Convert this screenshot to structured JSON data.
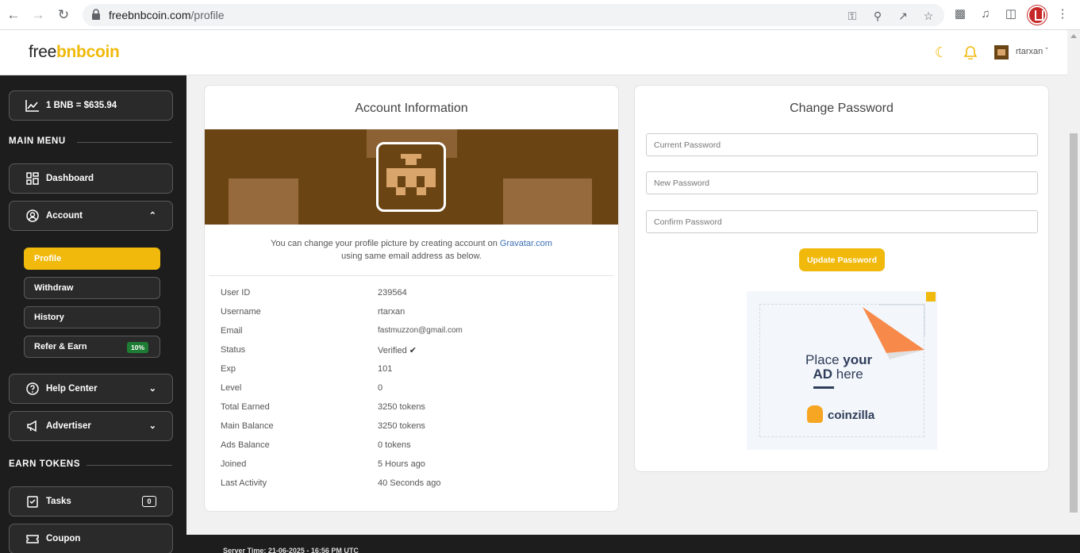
{
  "browser": {
    "url_host": "freebnbcoin.com",
    "url_path": "/profile"
  },
  "header": {
    "logo_part1": "free",
    "logo_part2": "bnbcoin",
    "username": "rtarxan"
  },
  "sidebar": {
    "price": "1 BNB = $635.94",
    "main_menu_heading": "MAIN MENU",
    "dashboard": "Dashboard",
    "account": "Account",
    "sub_items": [
      "Profile",
      "Withdraw",
      "History",
      "Refer & Earn"
    ],
    "refer_badge": "10%",
    "help_center": "Help Center",
    "advertiser": "Advertiser",
    "earn_heading": "EARN TOKENS",
    "tasks": "Tasks",
    "tasks_count": "0",
    "coupon": "Coupon"
  },
  "account_info": {
    "title": "Account Information",
    "note_before": "You can change your profile picture by creating account on ",
    "note_link": "Gravatar.com",
    "note_after": " using same email address as below.",
    "rows": [
      {
        "label": "User ID",
        "value": "239564"
      },
      {
        "label": "Username",
        "value": "rtarxan"
      },
      {
        "label": "Email",
        "value": "fastmuzzon@gmail.com"
      },
      {
        "label": "Status",
        "value": "Verified"
      },
      {
        "label": "Exp",
        "value": "101"
      },
      {
        "label": "Level",
        "value": "0"
      },
      {
        "label": "Total Earned",
        "value": "3250 tokens"
      },
      {
        "label": "Main Balance",
        "value": "3250 tokens"
      },
      {
        "label": "Ads Balance",
        "value": "0 tokens"
      },
      {
        "label": "Joined",
        "value": "5 Hours ago"
      },
      {
        "label": "Last Activity",
        "value": "40 Seconds ago"
      }
    ]
  },
  "change_password": {
    "title": "Change Password",
    "current_placeholder": "Current Password",
    "new_placeholder": "New Password",
    "confirm_placeholder": "Confirm Password",
    "button": "Update Password"
  },
  "ad": {
    "line1_a": "Place ",
    "line1_b": "your",
    "line2_a": "AD",
    "line2_b": " here",
    "brand": "coinzilla"
  },
  "footer": {
    "server_time": "Server Time: 21-06-2025 - 16:56 PM UTC"
  },
  "colors": {
    "accent": "#f0b90b",
    "sidebar_bg": "#1d1d1d",
    "badge_green": "#1e7d34"
  }
}
